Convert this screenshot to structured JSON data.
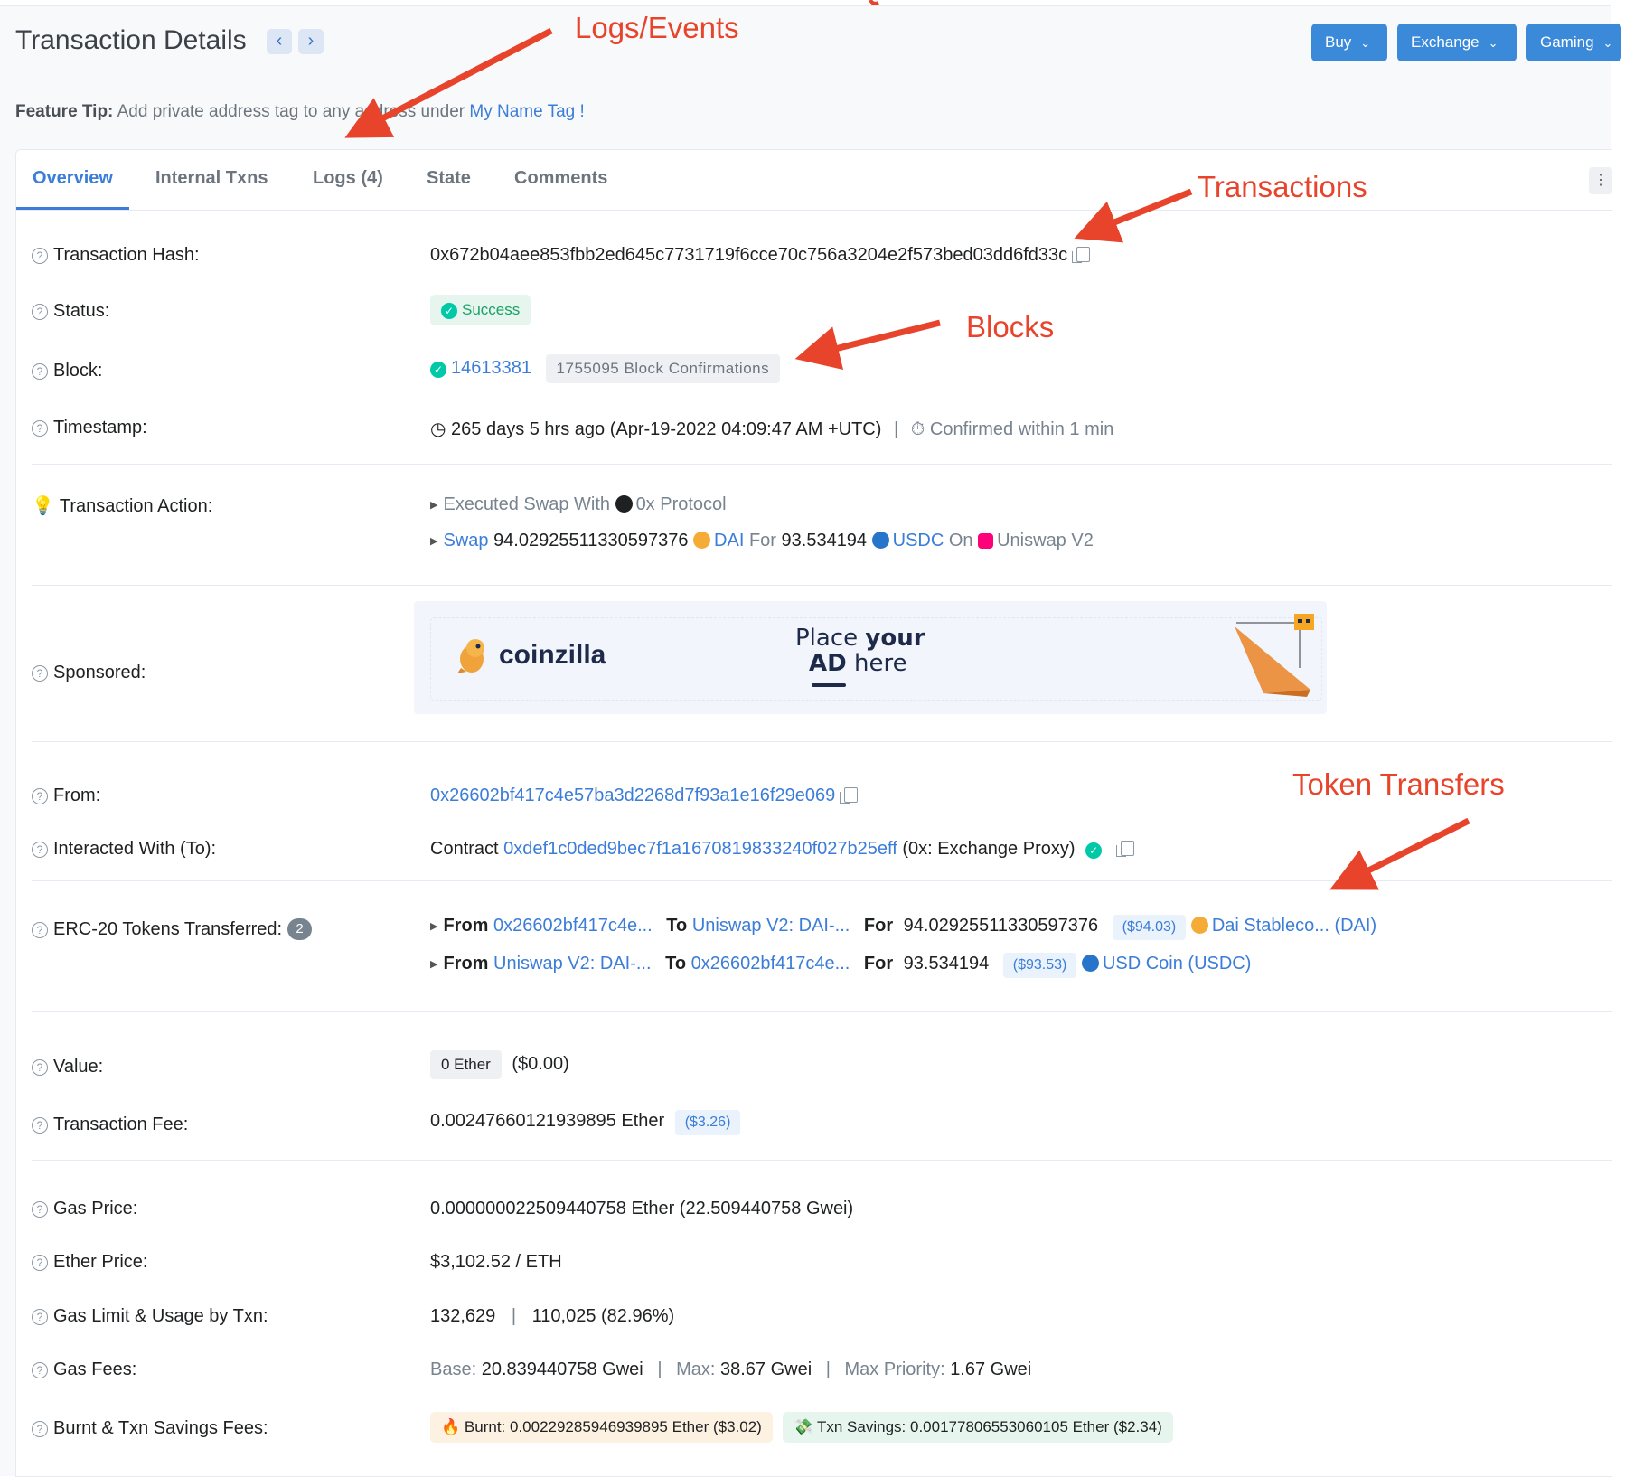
{
  "header": {
    "title": "Transaction Details",
    "prev_icon": "‹",
    "next_icon": "›",
    "buttons": [
      {
        "label": "Buy"
      },
      {
        "label": "Exchange"
      },
      {
        "label": "Gaming"
      }
    ]
  },
  "feature_tip": {
    "label": "Feature Tip:",
    "text": "Add private address tag to any address under",
    "link": "My Name Tag !"
  },
  "tabs": [
    {
      "label": "Overview",
      "active": true
    },
    {
      "label": "Internal Txns"
    },
    {
      "label": "Logs (4)"
    },
    {
      "label": "State"
    },
    {
      "label": "Comments"
    }
  ],
  "rows": {
    "tx_hash": {
      "label": "Transaction Hash:",
      "value": "0x672b04aee853fbb2ed645c7731719f6cce70c756a3204e2f573bed03dd6fd33c"
    },
    "status": {
      "label": "Status:",
      "value": "Success"
    },
    "block": {
      "label": "Block:",
      "number": "14613381",
      "confirmations": "1755095 Block Confirmations"
    },
    "timestamp": {
      "label": "Timestamp:",
      "value": "265 days 5 hrs ago (Apr-19-2022 04:09:47 AM +UTC)",
      "confirmed": "Confirmed within 1 min"
    },
    "action": {
      "label": "Transaction Action:",
      "line1_prefix": "Executed Swap With",
      "line1_protocol": "0x Protocol",
      "swap": "Swap",
      "amount_in": "94.02925511330597376",
      "token_in": "DAI",
      "for": "For",
      "amount_out": "93.534194",
      "token_out": "USDC",
      "on": "On",
      "dex": "Uniswap V2"
    },
    "sponsored": {
      "label": "Sponsored:",
      "brand": "coinzilla",
      "line1_a": "Place ",
      "line1_b": "your",
      "line2_a": "AD",
      "line2_b": " here"
    },
    "from": {
      "label": "From:",
      "value": "0x26602bf417c4e57ba3d2268d7f93a1e16f29e069"
    },
    "to": {
      "label": "Interacted With (To):",
      "prefix": "Contract",
      "address": "0xdef1c0ded9bec7f1a1670819833240f027b25eff",
      "name": "(0x: Exchange Proxy)"
    },
    "erc20": {
      "label": "ERC-20 Tokens Transferred:",
      "count": "2",
      "transfers": [
        {
          "from_label": "From",
          "from": "0x26602bf417c4e...",
          "to_label": "To",
          "to": "Uniswap V2: DAI-...",
          "for_label": "For",
          "amount": "94.02925511330597376",
          "usd": "($94.03)",
          "token": "Dai Stableco... (DAI)"
        },
        {
          "from_label": "From",
          "from": "Uniswap V2: DAI-...",
          "to_label": "To",
          "to": "0x26602bf417c4e...",
          "for_label": "For",
          "amount": "93.534194",
          "usd": "($93.53)",
          "token": "USD Coin (USDC)"
        }
      ]
    },
    "value": {
      "label": "Value:",
      "amount": "0 Ether",
      "usd": "($0.00)"
    },
    "tx_fee": {
      "label": "Transaction Fee:",
      "value": "0.00247660121939895 Ether",
      "usd": "($3.26)"
    },
    "gas_price": {
      "label": "Gas Price:",
      "value": "0.000000022509440758 Ether (22.509440758 Gwei)"
    },
    "ether_price": {
      "label": "Ether Price:",
      "value": "$3,102.52 / ETH"
    },
    "gas_limit": {
      "label": "Gas Limit & Usage by Txn:",
      "limit": "132,629",
      "usage": "110,025 (82.96%)"
    },
    "gas_fees": {
      "label": "Gas Fees:",
      "base_label": "Base:",
      "base": "20.839440758 Gwei",
      "max_label": "Max:",
      "max": "38.67 Gwei",
      "priority_label": "Max Priority:",
      "priority": "1.67 Gwei"
    },
    "burnt": {
      "label": "Burnt & Txn Savings Fees:",
      "burnt": "Burnt: 0.00229285946939895 Ether ($3.02)",
      "savings": "Txn Savings: 0.00177806553060105 Ether ($2.34)"
    }
  },
  "annotations": {
    "logs": "Logs/Events",
    "transactions": "Transactions",
    "blocks": "Blocks",
    "token_transfers": "Token Transfers"
  },
  "colors": {
    "accent": "#3b7dd8",
    "annotation": "#e8432b",
    "success": "#00c9a7"
  }
}
